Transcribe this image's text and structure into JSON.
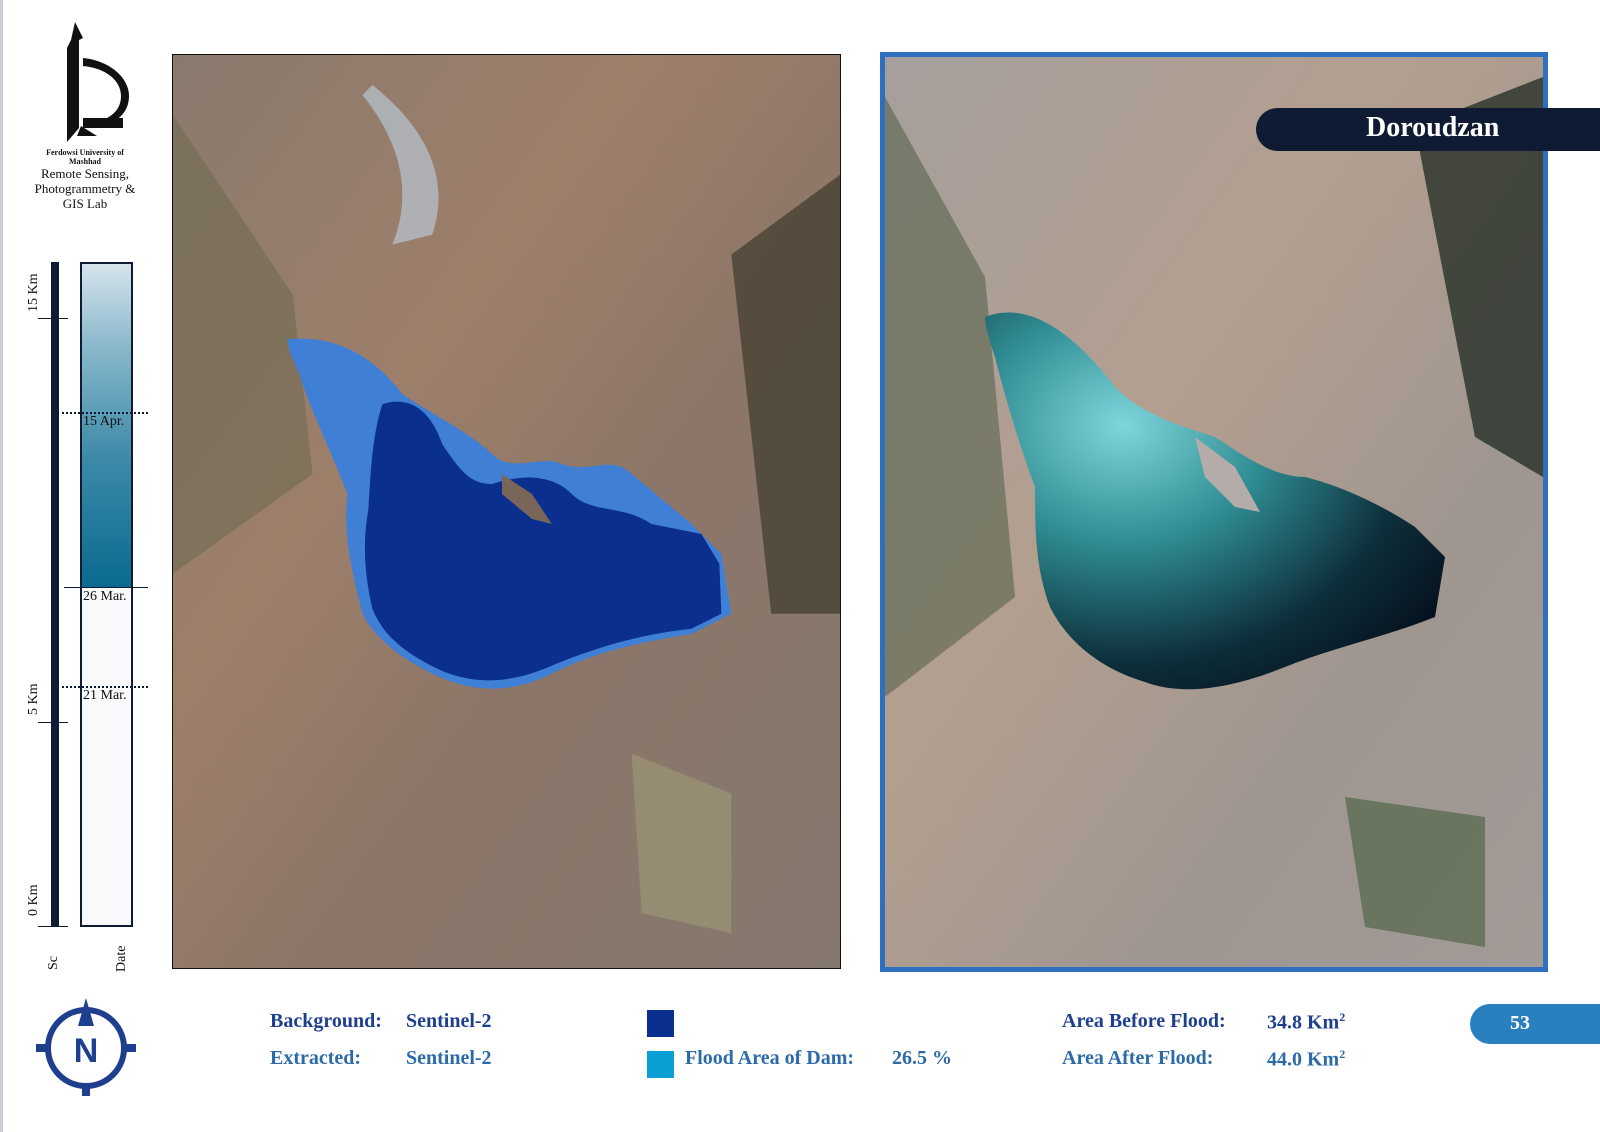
{
  "logo": {
    "university": "Ferdowsi University of Mashhad",
    "lab": "Remote Sensing, Photogrammetry & GIS Lab"
  },
  "scale": {
    "caption": "Sc",
    "labels": [
      "15 Km",
      "5 Km",
      "0 Km"
    ]
  },
  "dates": {
    "caption": "Date",
    "labels": [
      "15 Apr.",
      "26 Mar.",
      "21 Mar."
    ]
  },
  "title": "Doroudzan",
  "colors": {
    "flood_before": "#0b2f8f",
    "flood_added": "#0aa0d6",
    "frame": "#2f6fc0",
    "badge_dark": "#0f1a33",
    "page_badge": "#2a7fbf"
  },
  "legend": {
    "background_label": "Background:",
    "background_value": "Sentinel-2",
    "extracted_label": "Extracted:",
    "extracted_value": "Sentinel-2",
    "flood_area_label": "Flood Area of Dam:",
    "flood_area_value": "26.5 %",
    "area_before_label": "Area Before Flood:",
    "area_before_value": "34.8 Km",
    "area_after_label": "Area After Flood:",
    "area_after_value": "44.0 Km",
    "unit_superscript": "2"
  },
  "compass_letter": "N",
  "page_number": "53"
}
